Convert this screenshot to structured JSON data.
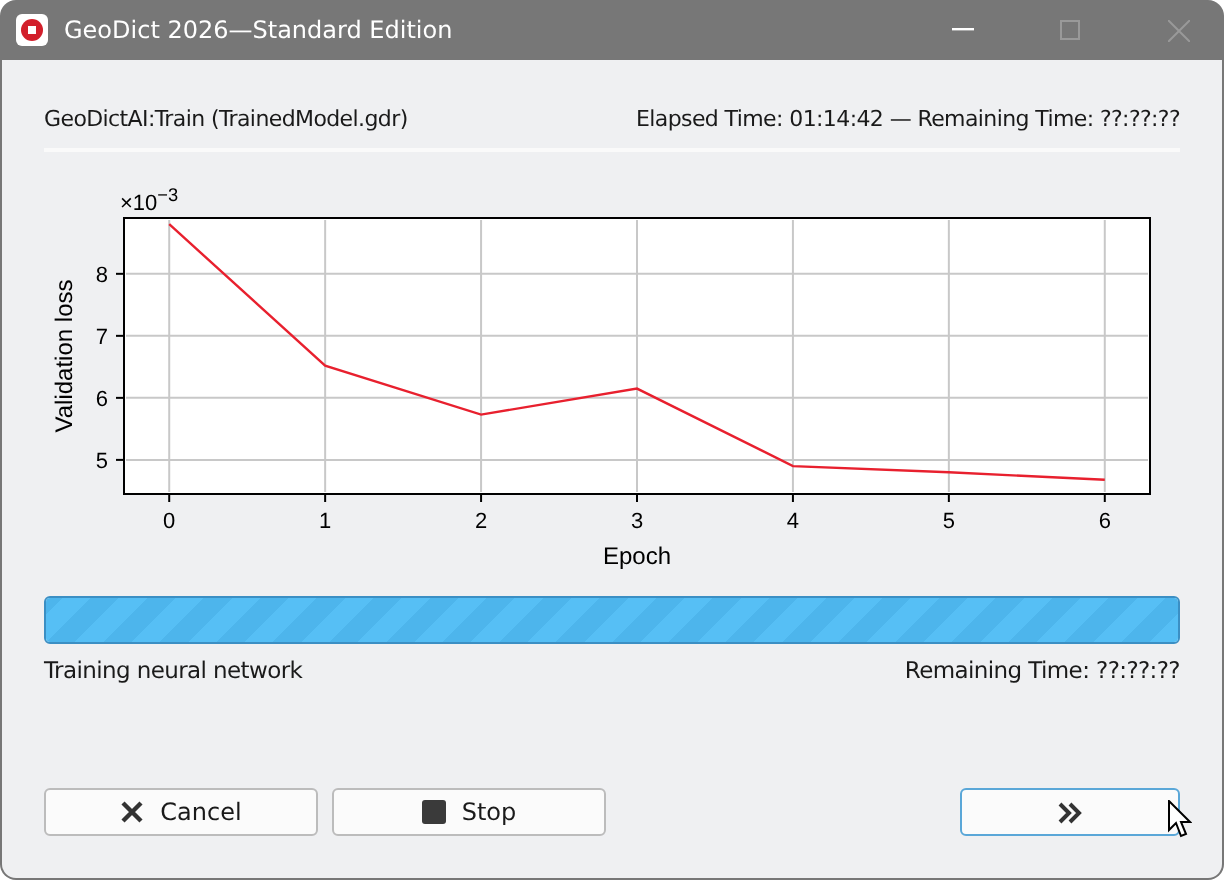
{
  "window": {
    "title": "GeoDict 2026—Standard Edition"
  },
  "header": {
    "task": "GeoDictAI:Train (TrainedModel.gdr)",
    "timing": "Elapsed Time: 01:14:42 — Remaining Time: ??:??:??"
  },
  "chart": {
    "chart_data": {
      "type": "line",
      "xlabel": "Epoch",
      "ylabel": "Validation loss",
      "x": [
        0,
        1,
        2,
        3,
        4,
        5,
        6
      ],
      "series": [
        {
          "color": "#e8202e",
          "values": [
            8.8,
            6.52,
            5.73,
            6.15,
            4.9,
            4.8,
            4.68
          ]
        }
      ],
      "xlim": [
        -0.29,
        6.29
      ],
      "ylim": [
        4.45,
        8.9
      ],
      "xticks": [
        0,
        1,
        2,
        3,
        4,
        5,
        6
      ],
      "yticks": [
        5,
        6,
        7,
        8
      ],
      "grid": true,
      "annotations": [
        "×10$^{−3}$"
      ]
    }
  },
  "progress": {
    "level": 1.0,
    "status": "Training neural network",
    "remaining": "Remaining Time: ??:??:??"
  },
  "buttons": [
    {
      "kind": "cancel",
      "label": "Cancel"
    },
    {
      "kind": "stop",
      "label": "Stop"
    },
    {
      "kind": "next"
    }
  ]
}
